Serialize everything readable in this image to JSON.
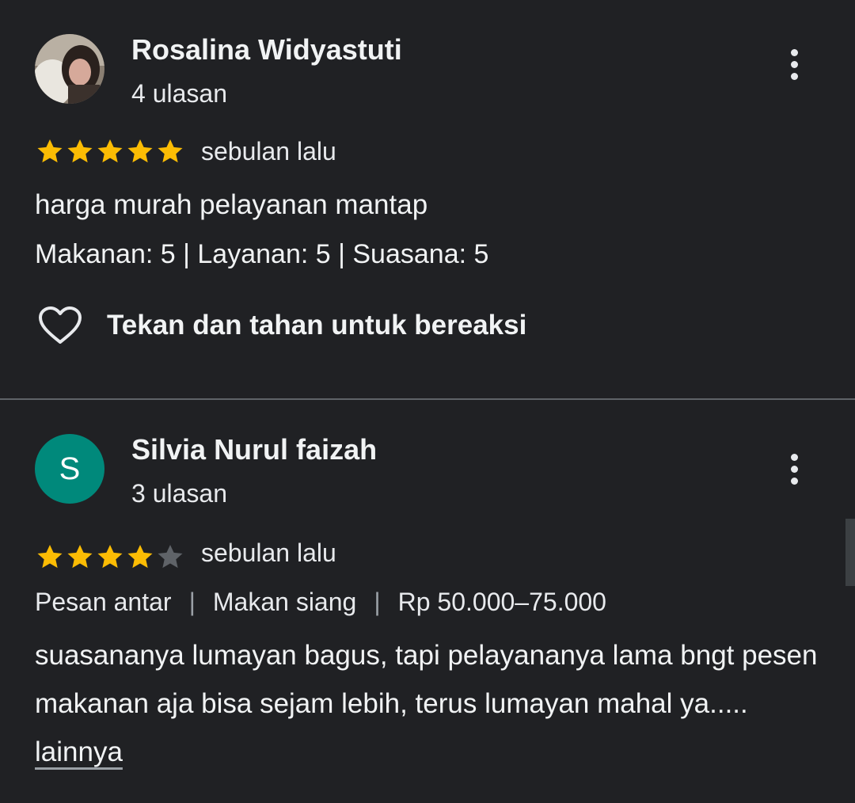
{
  "colors": {
    "background": "#202124",
    "star_filled": "#fbbc04",
    "star_empty": "#5f6368",
    "avatar_s": "#00897b"
  },
  "reviews": [
    {
      "author": "Rosalina Widyastuti",
      "review_count": "4 ulasan",
      "avatar": "profile-photo",
      "rating": 5,
      "time": "sebulan lalu",
      "text": "harga murah pelayanan mantap",
      "ratings_detail": "Makanan: 5 | Layanan: 5 | Suasana: 5",
      "react_label": "Tekan dan tahan untuk bereaksi"
    },
    {
      "author": "Silvia Nurul faizah",
      "review_count": "3 ulasan",
      "avatar_letter": "S",
      "rating": 4,
      "time": "sebulan lalu",
      "tags": [
        "Pesan antar",
        "Makan siang",
        "Rp 50.000–75.000"
      ],
      "text": "suasananya lumayan bagus, tapi pelayananya lama bngt pesen makanan aja bisa sejam lebih, terus lumayan mahal ya.....",
      "more_label": "lainnya"
    }
  ]
}
